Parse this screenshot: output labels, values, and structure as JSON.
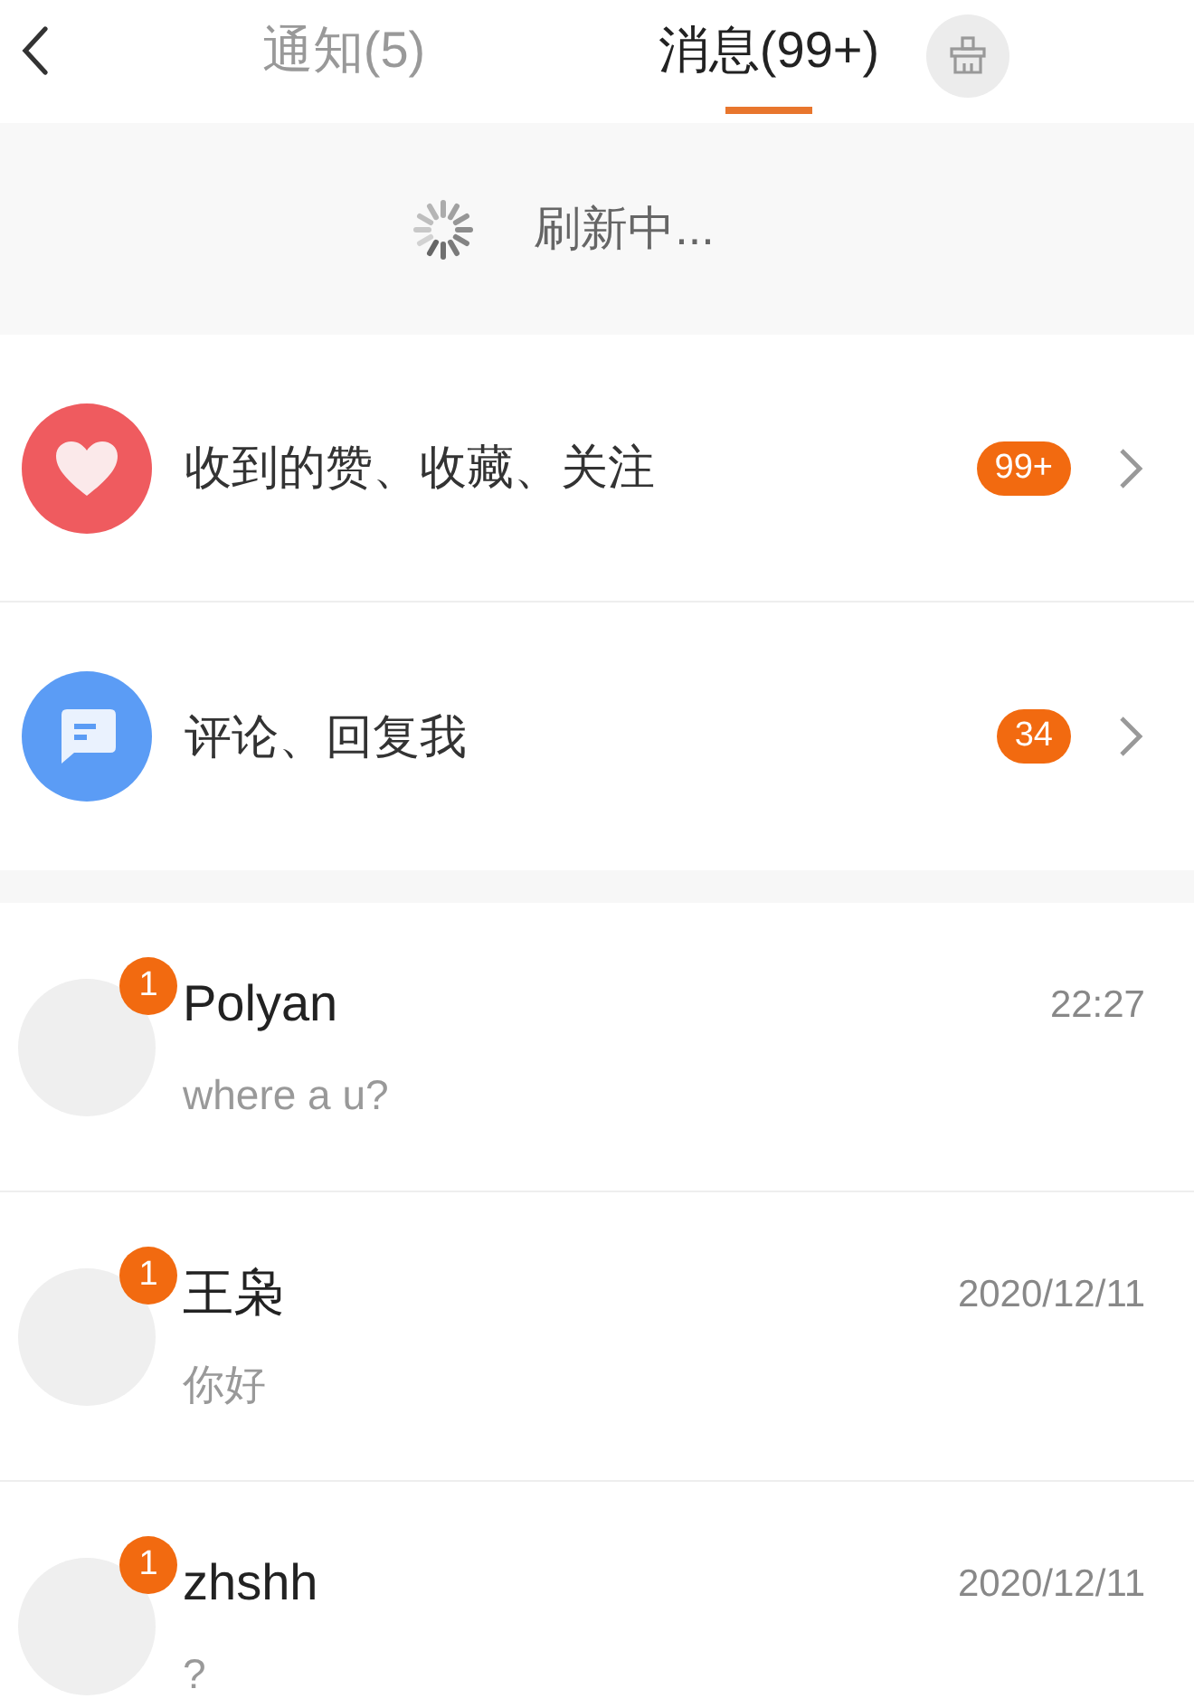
{
  "header": {
    "tabs": [
      {
        "label": "通知(5)",
        "selected": false
      },
      {
        "label": "消息(99+)",
        "selected": true
      }
    ]
  },
  "refresh": {
    "text": "刷新中..."
  },
  "categories": [
    {
      "kind": "likes",
      "label": "收到的赞、收藏、关注",
      "badge": "99+"
    },
    {
      "kind": "comments",
      "label": "评论、回复我",
      "badge": "34"
    }
  ],
  "chats": [
    {
      "name": "Polyan",
      "unread": "1",
      "time": "22:27",
      "message": "where a u?"
    },
    {
      "name": "王枭",
      "unread": "1",
      "time": "2020/12/11",
      "message": "你好"
    },
    {
      "name": "zhshh",
      "unread": "1",
      "time": "2020/12/11",
      "message": "?"
    }
  ]
}
